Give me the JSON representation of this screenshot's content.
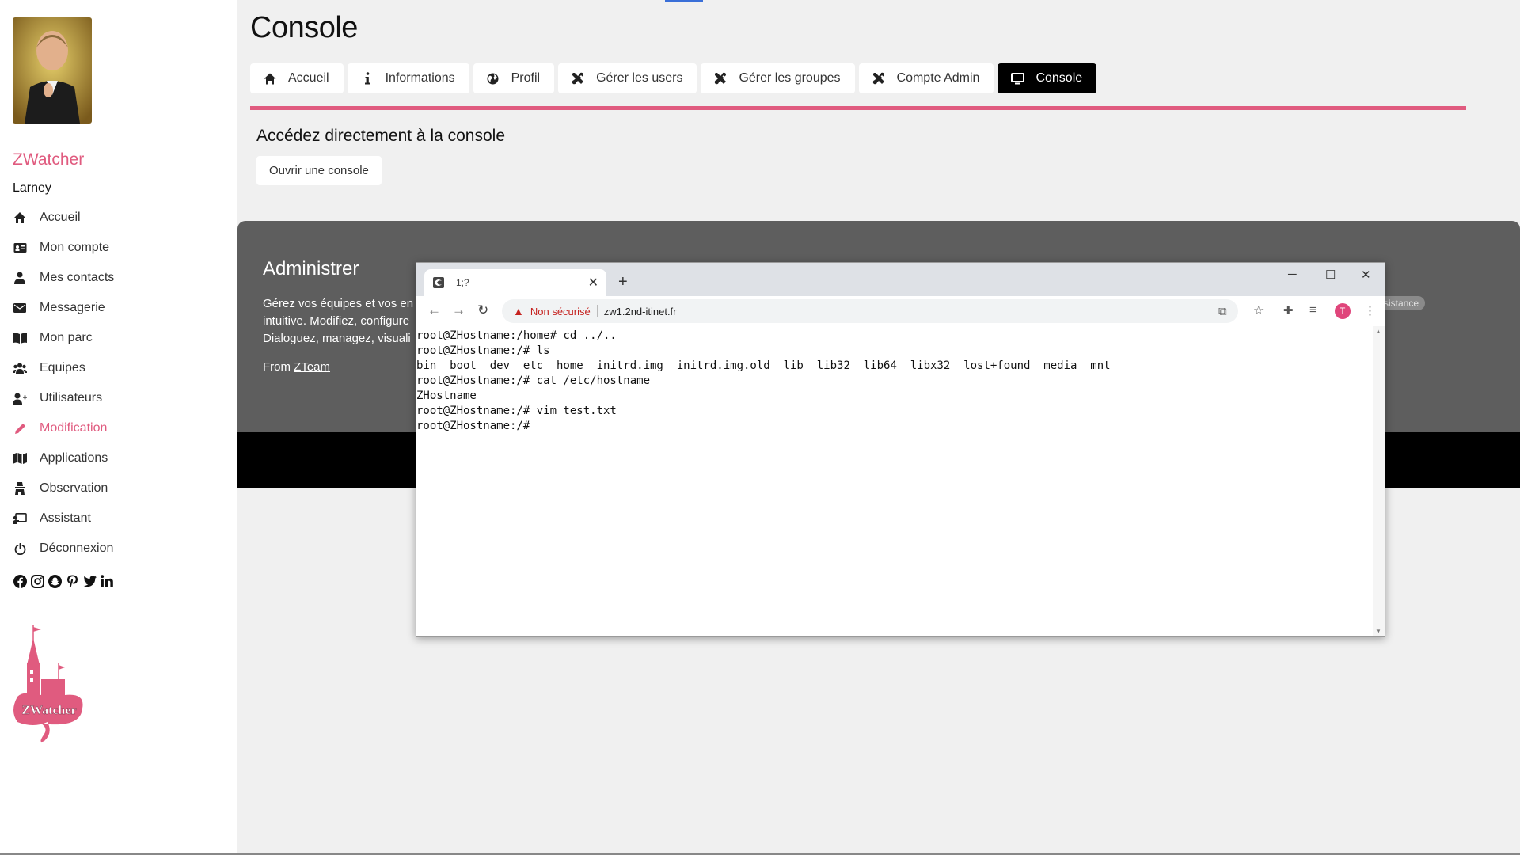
{
  "sidebar": {
    "brand": "ZWatcher",
    "username": "Larney",
    "items": [
      {
        "label": "Accueil",
        "icon": "home-icon"
      },
      {
        "label": "Mon compte",
        "icon": "id-card-icon"
      },
      {
        "label": "Mes contacts",
        "icon": "user-icon"
      },
      {
        "label": "Messagerie",
        "icon": "envelope-icon"
      },
      {
        "label": "Mon parc",
        "icon": "book-icon"
      },
      {
        "label": "Equipes",
        "icon": "users-icon"
      },
      {
        "label": "Utilisateurs",
        "icon": "user-plus-icon"
      },
      {
        "label": "Modification",
        "icon": "pencil-icon",
        "active": true
      },
      {
        "label": "Applications",
        "icon": "map-icon"
      },
      {
        "label": "Observation",
        "icon": "observation-icon"
      },
      {
        "label": "Assistant",
        "icon": "chalkboard-icon"
      },
      {
        "label": "Déconnexion",
        "icon": "power-icon"
      }
    ],
    "social": [
      "facebook-icon",
      "instagram-icon",
      "snapchat-icon",
      "pinterest-icon",
      "twitter-icon",
      "linkedin-icon"
    ],
    "logo_text": "ZWatcher"
  },
  "main": {
    "title": "Console",
    "tabs": [
      {
        "label": "Accueil",
        "icon": "home-icon"
      },
      {
        "label": "Informations",
        "icon": "info-icon"
      },
      {
        "label": "Profil",
        "icon": "globe-icon"
      },
      {
        "label": "Gérer les users",
        "icon": "tools-icon"
      },
      {
        "label": "Gérer les groupes",
        "icon": "tools-icon"
      },
      {
        "label": "Compte Admin",
        "icon": "tools-icon"
      },
      {
        "label": "Console",
        "icon": "monitor-icon",
        "active": true
      }
    ],
    "section_title": "Accédez directement à la console",
    "open_button": "Ouvrir une console"
  },
  "footer": {
    "title": "Administrer",
    "lines": [
      "Gérez vos équipes et vos en",
      "intuitive. Modifiez, configure",
      "Dialoguez, managez, visuali"
    ],
    "from_prefix": "From ",
    "from_link": "ZTeam",
    "pill": "sistance"
  },
  "browser": {
    "tab_title": "1;?",
    "not_secure": "Non sécurisé",
    "url": "zw1.2nd-itinet.fr",
    "profile_initial": "T",
    "terminal_lines": [
      "root@ZHostname:/home# cd ../..",
      "root@ZHostname:/# ls",
      "bin  boot  dev  etc  home  initrd.img  initrd.img.old  lib  lib32  lib64  libx32  lost+found  media  mnt",
      "root@ZHostname:/# cat /etc/hostname",
      "ZHostname",
      "root@ZHostname:/# vim test.txt",
      "root@ZHostname:/#"
    ]
  },
  "colors": {
    "accent": "#e05b7f",
    "footer_bg": "#5e5e5e",
    "active_tab": "#000000"
  }
}
